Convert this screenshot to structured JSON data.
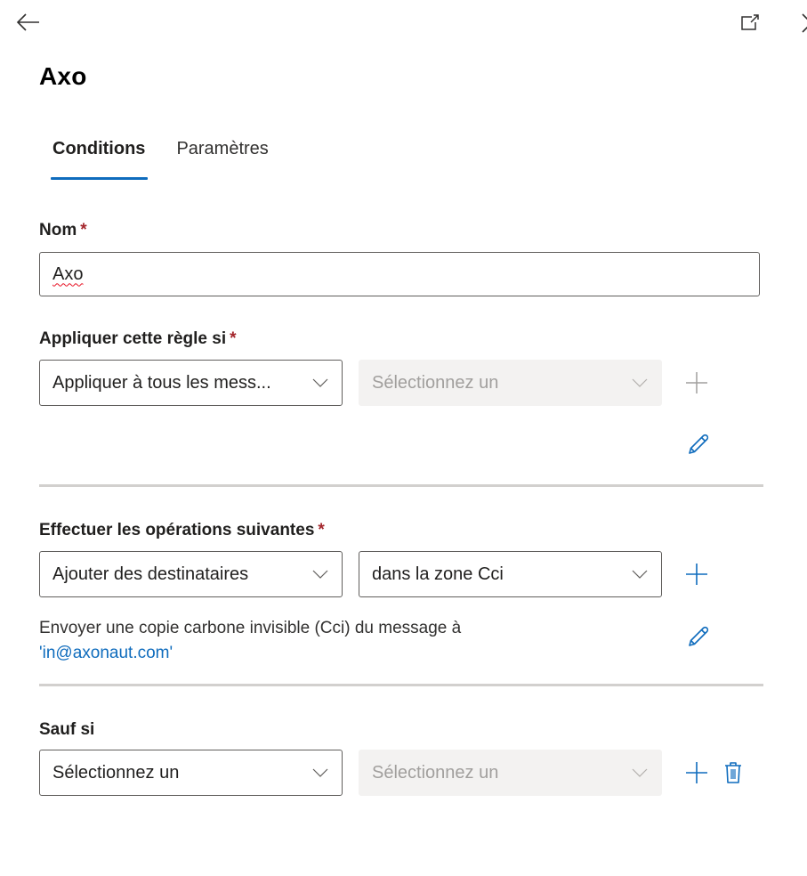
{
  "header": {
    "back_icon": "arrow-left-icon",
    "popout_icon": "open-in-new-window-icon",
    "close_icon": "close-icon"
  },
  "title": "Axo",
  "tabs": [
    {
      "label": "Conditions",
      "active": true
    },
    {
      "label": "Paramètres",
      "active": false
    }
  ],
  "name_field": {
    "label": "Nom",
    "required_mark": "*",
    "value": "Axo"
  },
  "apply_rule": {
    "label": "Appliquer cette règle si",
    "required_mark": "*",
    "condition_dropdown": "Appliquer à tous les mess...",
    "value_dropdown": "Sélectionnez un",
    "value_dropdown_disabled": true
  },
  "actions": {
    "label": "Effectuer les opérations suivantes",
    "required_mark": "*",
    "action_dropdown": "Ajouter des destinataires",
    "target_dropdown": "dans la zone Cci",
    "description": "Envoyer une copie carbone invisible (Cci) du message à",
    "recipient": "'in@axonaut.com'"
  },
  "exceptions": {
    "label": "Sauf si",
    "condition_dropdown": "Sélectionnez un",
    "value_dropdown": "Sélectionnez un",
    "value_dropdown_disabled": true
  },
  "colors": {
    "accent": "#0f6cbd",
    "required": "#a4262c",
    "disabled_bg": "#f3f2f1",
    "disabled_text": "#a19f9d",
    "divider": "#d2d0ce"
  }
}
